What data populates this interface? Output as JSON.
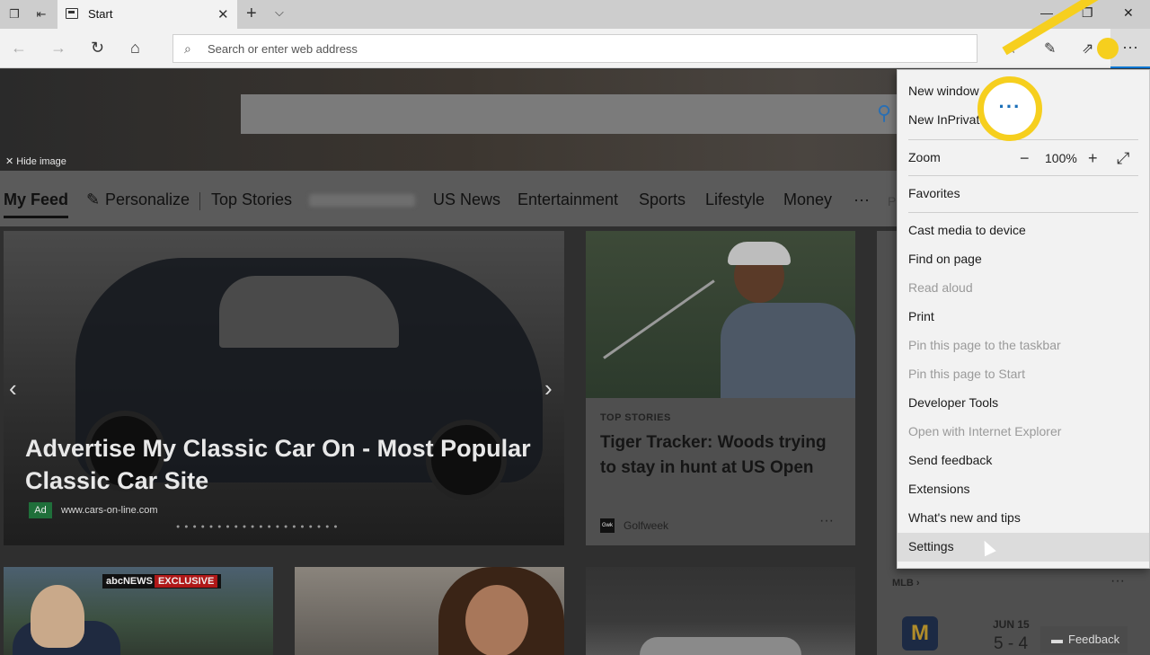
{
  "browser": {
    "tab": {
      "title": "Start"
    },
    "address_bar": {
      "placeholder": "Search or enter web address"
    }
  },
  "page": {
    "hide_image_label": "✕ Hide image",
    "feed_nav": {
      "items": [
        "My Feed",
        "Personalize",
        "Top Stories",
        "US News",
        "Entertainment",
        "Sports",
        "Lifestyle",
        "Money"
      ],
      "more": "···",
      "partial": "P"
    },
    "ad_card": {
      "headline": "Advertise My Classic Car On - Most Popular Classic Car Site",
      "badge": "Ad",
      "source": "www.cars-on-line.com"
    },
    "story_card": {
      "kicker": "TOP STORIES",
      "headline": "Tiger Tracker: Woods trying to stay in hunt at US Open",
      "source_logo": "Gwk",
      "source": "Golfweek"
    },
    "news_thumb": {
      "network": "abcNEWS",
      "tag": "EXCLUSIVE"
    },
    "mlb": {
      "label": "MLB",
      "date": "JUN 15",
      "score": "5 - 4",
      "logo_letter": "M"
    },
    "feedback_label": "Feedback"
  },
  "menu": {
    "new_window": "New window",
    "new_inprivate": "New InPrivate window",
    "zoom_label": "Zoom",
    "zoom_value": "100%",
    "favorites": "Favorites",
    "items": [
      {
        "label": "Cast media to device",
        "disabled": false
      },
      {
        "label": "Find on page",
        "disabled": false
      },
      {
        "label": "Read aloud",
        "disabled": true
      },
      {
        "label": "Print",
        "disabled": false
      },
      {
        "label": "Pin this page to the taskbar",
        "disabled": true
      },
      {
        "label": "Pin this page to Start",
        "disabled": true
      },
      {
        "label": "Developer Tools",
        "disabled": false
      },
      {
        "label": "Open with Internet Explorer",
        "disabled": true
      },
      {
        "label": "Send feedback",
        "disabled": false
      },
      {
        "label": "Extensions",
        "disabled": false
      },
      {
        "label": "What's new and tips",
        "disabled": false
      },
      {
        "label": "Settings",
        "disabled": false,
        "hovered": true
      }
    ]
  },
  "callout": {
    "symbol": "···",
    "color": "#f6cf1e"
  },
  "icons": {
    "back": "back-arrow-icon",
    "forward": "forward-arrow-icon",
    "refresh": "refresh-icon",
    "home": "home-icon",
    "favorites": "star-list-icon",
    "notes": "pen-icon",
    "share": "share-icon",
    "more": "ellipsis-icon"
  }
}
